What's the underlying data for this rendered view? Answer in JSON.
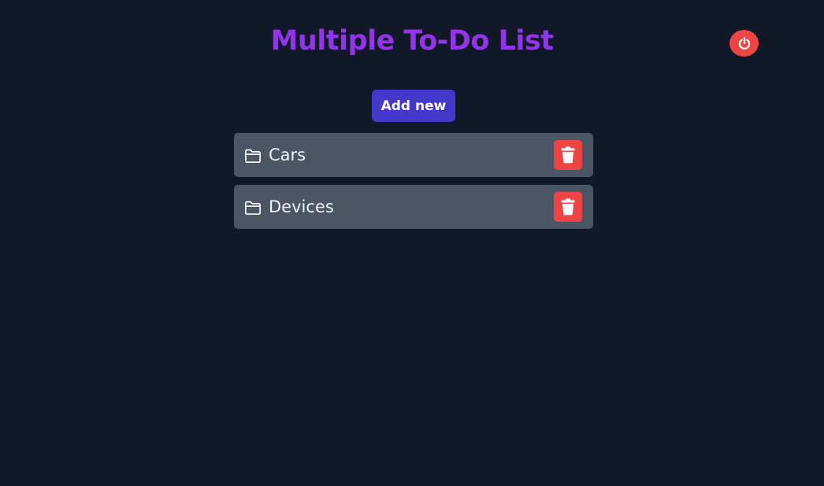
{
  "header": {
    "title": "Multiple To-Do List",
    "logout_icon": "power-icon"
  },
  "actions": {
    "add_new_label": "Add new"
  },
  "lists": [
    {
      "label": "Cars",
      "icon": "folder-icon",
      "delete_icon": "trash-icon"
    },
    {
      "label": "Devices",
      "icon": "folder-icon",
      "delete_icon": "trash-icon"
    }
  ],
  "colors": {
    "background": "#111827",
    "title": "#9333ea",
    "accent_button": "#4338ca",
    "danger": "#ef4444",
    "list_item": "#4b5563",
    "text": "#f3f4f6"
  }
}
